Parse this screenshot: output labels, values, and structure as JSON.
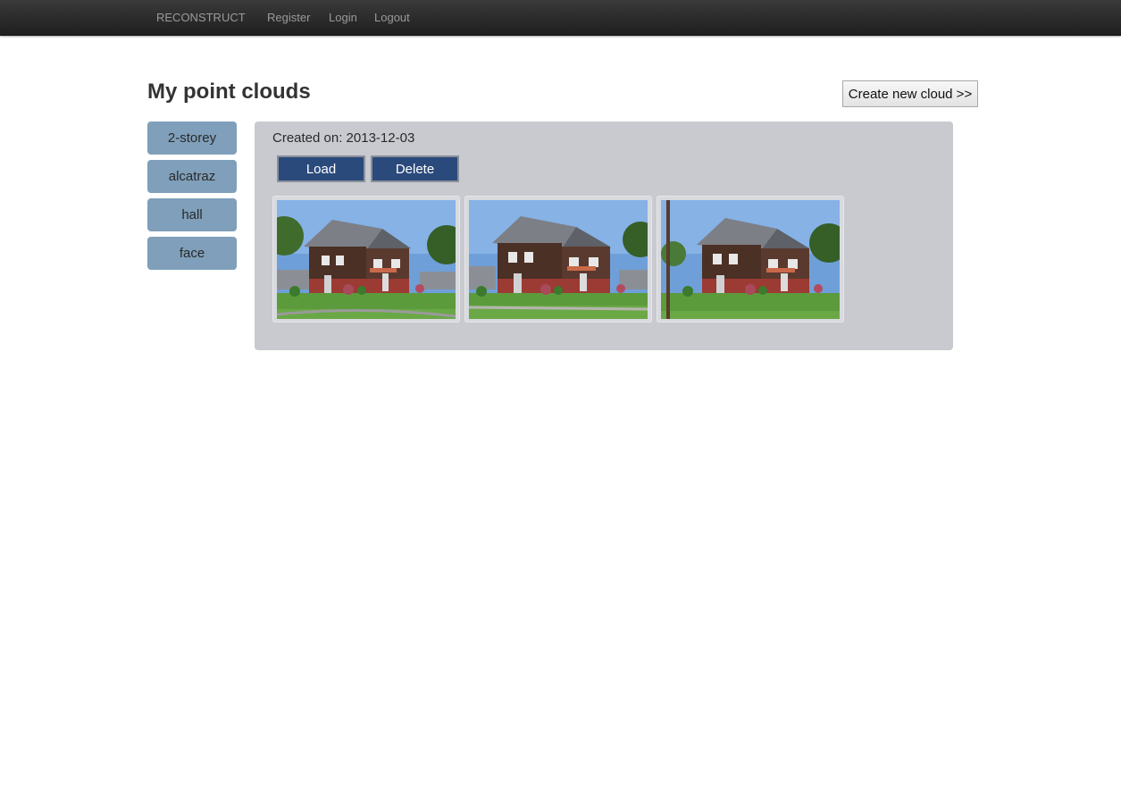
{
  "navbar": {
    "brand": "RECONSTRUCT",
    "links": [
      "Register",
      "Login",
      "Logout"
    ]
  },
  "page": {
    "title": "My point clouds",
    "create_button": "Create new cloud >>"
  },
  "clouds": [
    "2-storey",
    "alcatraz",
    "hall",
    "face"
  ],
  "selected_cloud": {
    "created_label": "Created on: 2013-12-03",
    "load_label": "Load",
    "delete_label": "Delete",
    "thumbnails": [
      "house-photo-1",
      "house-photo-2",
      "house-photo-3"
    ]
  },
  "colors": {
    "navbar": "#262626",
    "cloud_item": "#7f9fba",
    "panel": "#c8cad0",
    "action_button": "#2b4a7c"
  }
}
